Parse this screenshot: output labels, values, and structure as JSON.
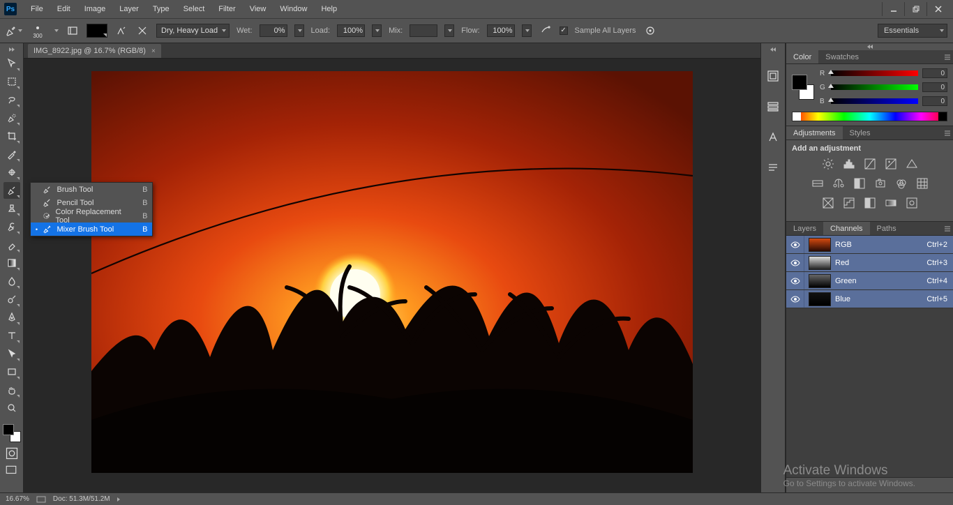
{
  "menubar": [
    "File",
    "Edit",
    "Image",
    "Layer",
    "Type",
    "Select",
    "Filter",
    "View",
    "Window",
    "Help"
  ],
  "options": {
    "brush_size": "300",
    "brush_preset": "Dry, Heavy Load",
    "wet_label": "Wet:",
    "wet_val": "0%",
    "load_label": "Load:",
    "load_val": "100%",
    "mix_label": "Mix:",
    "mix_val": "",
    "flow_label": "Flow:",
    "flow_val": "100%",
    "sample_label": "Sample All Layers",
    "workspace": "Essentials"
  },
  "document": {
    "tab_title": "IMG_8922.jpg @ 16.7% (RGB/8)"
  },
  "flyout": {
    "items": [
      {
        "label": "Brush Tool",
        "key": "B"
      },
      {
        "label": "Pencil Tool",
        "key": "B"
      },
      {
        "label": "Color Replacement Tool",
        "key": "B"
      },
      {
        "label": "Mixer Brush Tool",
        "key": "B"
      }
    ]
  },
  "color": {
    "tab1": "Color",
    "tab2": "Swatches",
    "channels": [
      {
        "ch": "R",
        "val": "0",
        "grad": "linear-gradient(to right,#000,#f00)"
      },
      {
        "ch": "G",
        "val": "0",
        "grad": "linear-gradient(to right,#000,#0f0)"
      },
      {
        "ch": "B",
        "val": "0",
        "grad": "linear-gradient(to right,#000,#00f)"
      }
    ]
  },
  "adjustments": {
    "tab1": "Adjustments",
    "tab2": "Styles",
    "header": "Add an adjustment"
  },
  "channels_panel": {
    "tabs": [
      "Layers",
      "Channels",
      "Paths"
    ],
    "rows": [
      {
        "name": "RGB",
        "sc": "Ctrl+2"
      },
      {
        "name": "Red",
        "sc": "Ctrl+3"
      },
      {
        "name": "Green",
        "sc": "Ctrl+4"
      },
      {
        "name": "Blue",
        "sc": "Ctrl+5"
      }
    ]
  },
  "status": {
    "zoom": "16.67%",
    "doc": "Doc: 51.3M/51.2M"
  },
  "watermark": {
    "t1": "Activate Windows",
    "t2": "Go to Settings to activate Windows."
  }
}
